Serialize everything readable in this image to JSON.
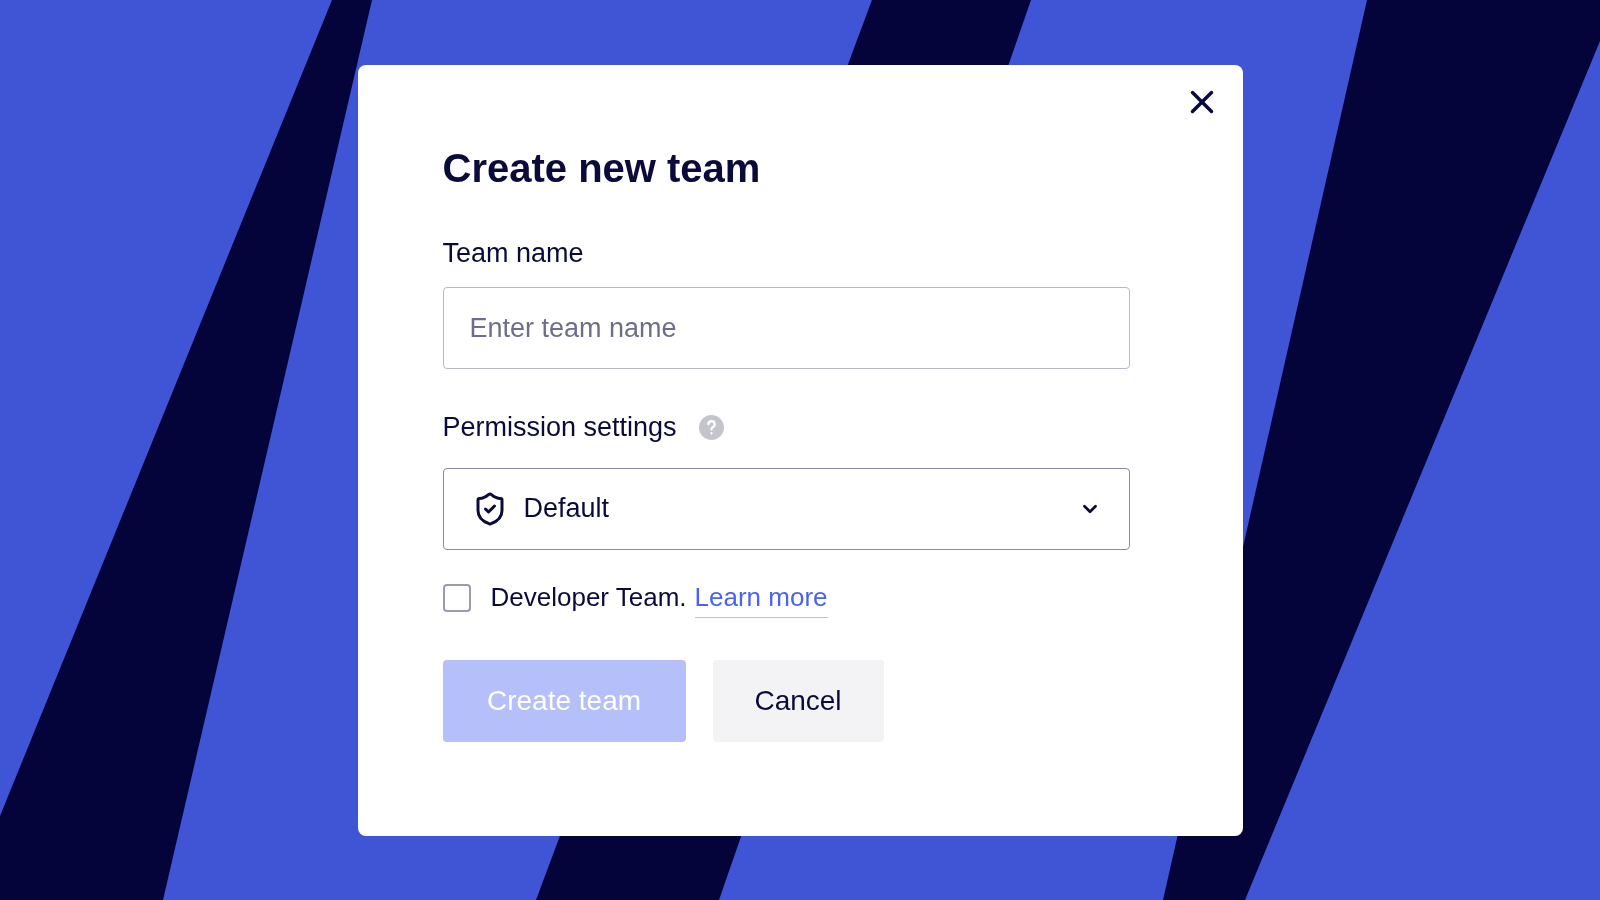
{
  "dialog": {
    "title": "Create new team",
    "team_name": {
      "label": "Team name",
      "placeholder": "Enter team name"
    },
    "permission": {
      "label": "Permission settings",
      "value": "Default"
    },
    "developer": {
      "label": "Developer Team.",
      "link": "Learn more",
      "checked": false
    },
    "buttons": [
      {
        "label": "Create team",
        "kind": "primary",
        "disabled": true
      },
      {
        "label": "Cancel",
        "kind": "secondary",
        "disabled": false
      }
    ]
  }
}
